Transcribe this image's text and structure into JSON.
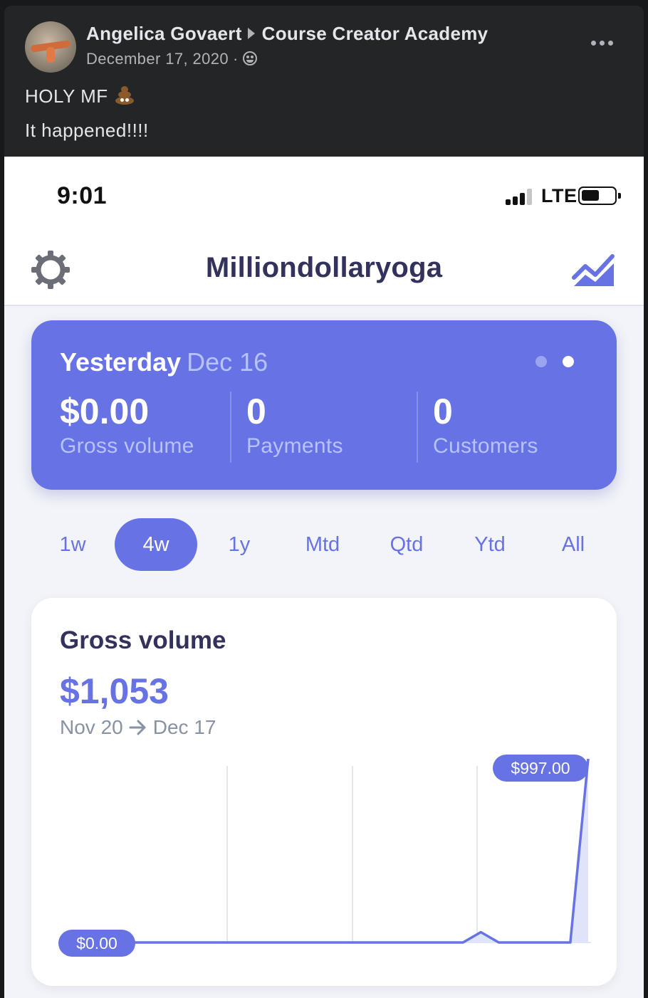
{
  "post": {
    "author": "Angelica Govaert",
    "group": "Course Creator Academy",
    "date": "December 17, 2020",
    "line1": "HOLY MF",
    "line2": "It happened!!!!"
  },
  "status_bar": {
    "time": "9:01",
    "network": "LTE"
  },
  "app": {
    "title": "Milliondollaryoga"
  },
  "summary": {
    "label": "Yesterday",
    "date": "Dec 16",
    "gross_volume": "$0.00",
    "gross_volume_label": "Gross volume",
    "payments": "0",
    "payments_label": "Payments",
    "customers": "0",
    "customers_label": "Customers"
  },
  "ranges": [
    "1w",
    "4w",
    "1y",
    "Mtd",
    "Qtd",
    "Ytd",
    "All"
  ],
  "active_range": "4w",
  "chart": {
    "title": "Gross volume",
    "total": "$1,053",
    "start_date": "Nov 20",
    "end_date": "Dec 17",
    "start_label": "$0.00",
    "end_label": "$997.00"
  },
  "chart_data": {
    "type": "area",
    "title": "Gross volume",
    "x": [
      "Nov 20",
      "Dec 17"
    ],
    "series": [
      {
        "values": [
          0,
          0,
          0,
          0,
          0,
          0,
          0,
          0,
          0,
          0,
          0,
          0,
          0,
          0,
          0,
          0,
          0,
          0,
          0,
          0,
          0,
          56,
          0,
          0,
          0,
          0,
          0,
          997
        ]
      }
    ],
    "ylim": [
      0,
      997
    ],
    "annotations": [
      "$0.00",
      "$997.00"
    ]
  },
  "colors": {
    "accent": "#6772e5",
    "accent_light": "#b6c3ff",
    "title_text": "#32325d",
    "muted_text": "#8792a2",
    "fb_bg": "#242526"
  }
}
